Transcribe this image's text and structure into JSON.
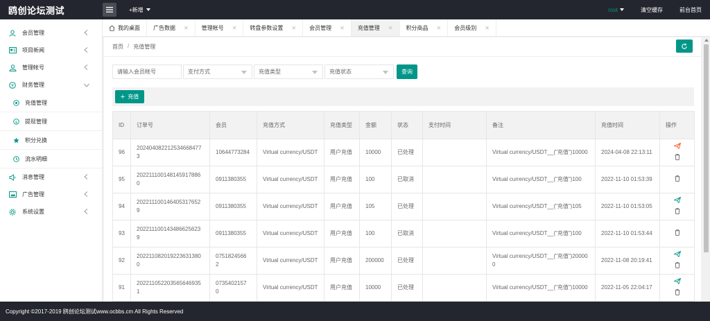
{
  "app": {
    "title": "鸥创论坛测试"
  },
  "topbar": {
    "add_new": "+新增",
    "user": "root",
    "clear_cache": "清空缓存",
    "frontend": "前台首页"
  },
  "sidebar": {
    "items": [
      {
        "label": "会员管理",
        "icon": "user-icon"
      },
      {
        "label": "项目新闻",
        "icon": "news-icon"
      },
      {
        "label": "管理帐号",
        "icon": "admin-icon"
      },
      {
        "label": "财务管理",
        "icon": "finance-icon",
        "expanded": true
      },
      {
        "label": "消息管理",
        "icon": "message-icon"
      },
      {
        "label": "广告管理",
        "icon": "ad-icon"
      },
      {
        "label": "系统设置",
        "icon": "settings-icon"
      }
    ],
    "sub_items": [
      {
        "label": "充值管理",
        "icon": "recharge-icon"
      },
      {
        "label": "提现管理",
        "icon": "withdraw-icon"
      },
      {
        "label": "积分兑换",
        "icon": "star-icon"
      },
      {
        "label": "流水明细",
        "icon": "clock-icon"
      }
    ]
  },
  "tabs": [
    {
      "label": "我的桌面",
      "icon": "home-icon"
    },
    {
      "label": "广告数据"
    },
    {
      "label": "管理帐号"
    },
    {
      "label": "转盘参数设置"
    },
    {
      "label": "会员管理"
    },
    {
      "label": "充值管理",
      "active": true
    },
    {
      "label": "积分商品"
    },
    {
      "label": "会员级别"
    }
  ],
  "breadcrumb": {
    "home": "首页",
    "sep": "/",
    "current": "充值管理"
  },
  "search": {
    "member_placeholder": "请输入会员帐号",
    "pay_method": "支付方式",
    "recharge_type": "充值类型",
    "recharge_status": "充值状态",
    "query": "查询"
  },
  "toolbar": {
    "add_label": "充值"
  },
  "table": {
    "headers": [
      "ID",
      "订单号",
      "会员",
      "充值方式",
      "充值类型",
      "金额",
      "状态",
      "支付时间",
      "备注",
      "充值时间",
      "操作"
    ],
    "rows": [
      {
        "id": "96",
        "order": "202404082212534668477 3",
        "member": "10644773284",
        "method": "Virtual currency/USDT",
        "type": "用户充值",
        "amount": "10000",
        "status": "已处理",
        "pay_time": "",
        "remark": "Virtual currency/USDT__(\"充值\")10000",
        "time": "2024-04-08 22:13:11",
        "send": true
      },
      {
        "id": "95",
        "order": "202211100148145917886 0",
        "member": "0911380355",
        "method": "Virtual currency/USDT",
        "type": "用户充值",
        "amount": "100",
        "status": "已取消",
        "pay_time": "",
        "remark": "Virtual currency/USDT__(\"充值\")100",
        "time": "2022-11-10 01:53:39",
        "send": false
      },
      {
        "id": "94",
        "order": "202211100146405317652 9",
        "member": "0911380355",
        "method": "Virtual currency/USDT",
        "type": "用户充值",
        "amount": "105",
        "status": "已处理",
        "pay_time": "",
        "remark": "Virtual currency/USDT__(\"充值\")105",
        "time": "2022-11-10 01:53:05",
        "send": true
      },
      {
        "id": "93",
        "order": "202211100143486625623 9",
        "member": "0911380355",
        "method": "Virtual currency/USDT",
        "type": "用户充值",
        "amount": "100",
        "status": "已取消",
        "pay_time": "",
        "remark": "Virtual currency/USDT__(\"充值\")100",
        "time": "2022-11-10 01:53:44",
        "send": false
      },
      {
        "id": "92",
        "order": "202211082019223631380 0",
        "member": "0751824566 2",
        "method": "Virtual currency/USDT",
        "type": "用户充值",
        "amount": "200000",
        "status": "已处理",
        "pay_time": "",
        "remark": "Virtual currency/USDT__(\"充值\")200000",
        "time": "2022-11-08 20:19:41",
        "send": true
      },
      {
        "id": "91",
        "order": "202211052203565646935 1",
        "member": "0735402157 0",
        "method": "Virtual currency/USDT",
        "type": "用户充值",
        "amount": "10000",
        "status": "已处理",
        "pay_time": "",
        "remark": "Virtual currency/USDT__(\"充值\")10000",
        "time": "2022-11-05 22:04:17",
        "send": true
      }
    ]
  },
  "footer": {
    "text": "Copyright ©2017-2019 鸥创论坛测试www.ocbbs.cm All Rights Reserved"
  },
  "colors": {
    "accent": "#009688",
    "dark": "#23262e",
    "send_red": "#ff5722",
    "send_green": "#009688"
  }
}
